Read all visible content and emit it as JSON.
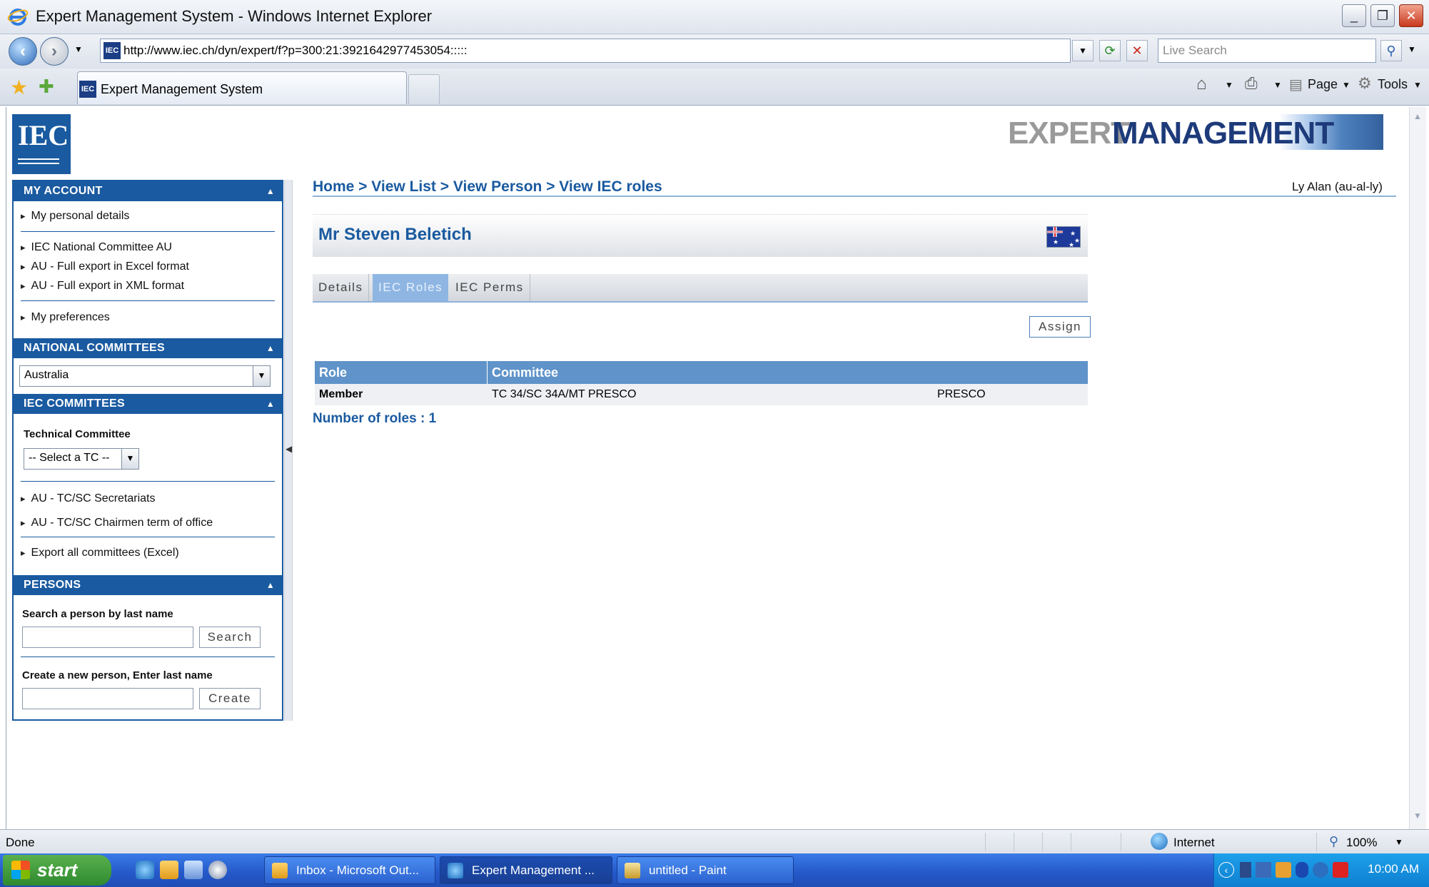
{
  "window": {
    "title": "Expert Management System - Windows Internet Explorer",
    "url": "http://www.iec.ch/dyn/expert/f?p=300:21:3921642977453054:::::",
    "search_placeholder": "Live Search",
    "tab_title": "Expert Management System",
    "toolbar": {
      "page": "Page",
      "tools": "Tools"
    }
  },
  "brand": {
    "iec_logo": "IEC",
    "app_logo_part1": "EXPERT",
    "app_logo_part2": "MANAGEMENT"
  },
  "sidebar": {
    "my_account": {
      "title": "MY ACCOUNT",
      "links": [
        "My personal details",
        "IEC National Committee AU",
        "AU - Full export in Excel format",
        "AU - Full export in XML format",
        "My preferences"
      ]
    },
    "national_committees": {
      "title": "NATIONAL COMMITTEES",
      "selected": "Australia"
    },
    "iec_committees": {
      "title": "IEC COMMITTEES",
      "tc_label": "Technical Committee",
      "tc_select": "-- Select a TC --",
      "links": [
        "AU - TC/SC Secretariats",
        "AU - TC/SC Chairmen term of office",
        "Export all committees (Excel)"
      ]
    },
    "persons": {
      "title": "PERSONS",
      "search_label": "Search a person by last name",
      "search_button": "Search",
      "create_label": "Create a new person, Enter last name",
      "create_button": "Create"
    }
  },
  "main": {
    "breadcrumb": "Home > View List > View Person > View IEC roles",
    "user": "Ly Alan (au-al-ly)",
    "person_name": "Mr Steven Beletich",
    "tabs": [
      "Details",
      "IEC Roles",
      "IEC Perms"
    ],
    "active_tab": "IEC Roles",
    "assign_button": "Assign",
    "table": {
      "headers": [
        "Role",
        "Committee"
      ],
      "rows": [
        {
          "role": "Member",
          "committee": "TC 34/SC 34A/MT PRESCO",
          "code": "PRESCO"
        }
      ]
    },
    "count_text": "Number of roles : 1"
  },
  "statusbar": {
    "status": "Done",
    "zone": "Internet",
    "zoom": "100%"
  },
  "taskbar": {
    "start": "start",
    "tasks": [
      "Inbox - Microsoft Out...",
      "Expert Management ...",
      "untitled - Paint"
    ],
    "clock": "10:00 AM"
  },
  "colors": {
    "accent": "#1a5aa0",
    "table_header": "#5f93c9",
    "active_tab": "#8fb6e3"
  }
}
